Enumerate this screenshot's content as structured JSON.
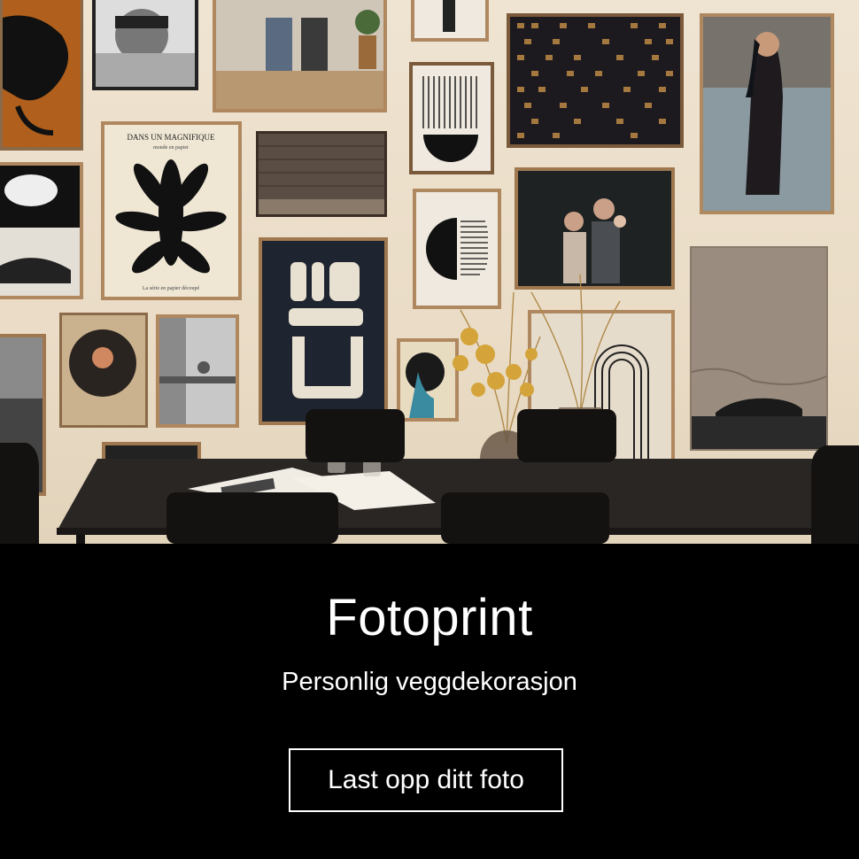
{
  "hero": {
    "poster_title": "DANS UN MAGNIFIQUE",
    "poster_subtitle": "monde en papier",
    "poster_caption": "La série en papier découpé"
  },
  "banner": {
    "title": "Fotoprint",
    "subtitle": "Personlig veggdekorasjon",
    "cta_label": "Last opp ditt foto"
  },
  "colors": {
    "banner_background": "#000000",
    "text": "#ffffff",
    "wall": "#ece0cc",
    "frame_wood": "#a07850"
  }
}
